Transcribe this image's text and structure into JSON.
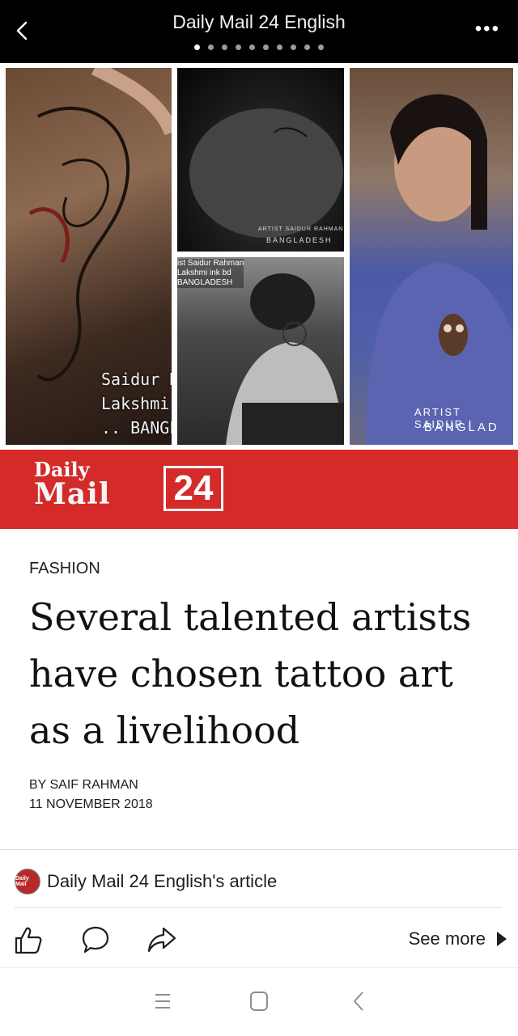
{
  "topbar": {
    "title": "Daily Mail 24 English",
    "page_dots": 10,
    "active_dot": 0,
    "icons": {
      "back": "chevron-left-icon",
      "more": "more-dots-icon"
    },
    "more_label": "•••"
  },
  "collage": {
    "photo1_watermark": "Saidur Ra\nLakshmi i\n.. BANGLAI",
    "photo2_watermark_line1": "ARTIST SAIDUR RAHMAN",
    "photo2_watermark_line2": "BANGLADESH",
    "photo3_watermark": "ist Saidur Rahman\nLakshmi ink bd\nBANGLADESH",
    "photo4_watermark_line1": "ARTIST SAIDUR I",
    "photo4_watermark_line2": "BANGLAD"
  },
  "banner": {
    "logo_daily": "Daily",
    "logo_mail": "Mail",
    "logo_number": "24",
    "color": "#d42a2a"
  },
  "article": {
    "category": "FASHION",
    "headline": "Several talented artists have chosen tattoo art as a livelihood",
    "byline": "BY SAIF RAHMAN",
    "date": "11 NOVEMBER 2018"
  },
  "source": {
    "label": "Daily Mail 24 English's article",
    "avatar_text": "Daily Mail"
  },
  "actions": {
    "icons": [
      "like-icon",
      "comment-icon",
      "share-icon"
    ],
    "see_more": "See more"
  },
  "navbar": {
    "icons": [
      "menu-icon",
      "home-square-icon",
      "back-icon"
    ]
  }
}
